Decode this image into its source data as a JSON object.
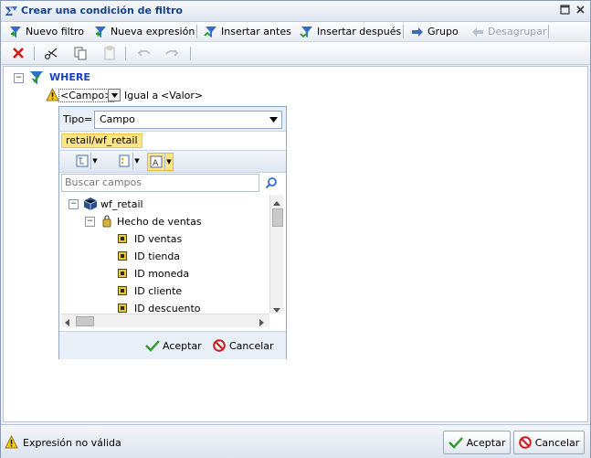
{
  "window": {
    "title": "Crear una condición de filtro"
  },
  "toolbar": {
    "nuevo_filtro": "Nuevo filtro",
    "nueva_expresion": "Nueva expresión",
    "insertar_antes": "Insertar antes",
    "insertar_despues": "Insertar después",
    "grupo": "Grupo",
    "desagrupar": "Desagrupar"
  },
  "filter": {
    "root": "WHERE",
    "field_placeholder": "<Campo>",
    "operator": "Igual a",
    "value_placeholder": "<Valor>"
  },
  "popup": {
    "tipo_label": "Tipo=",
    "tipo_value": "Campo",
    "breadcrumb": "retail/wf_retail",
    "search_placeholder": "Buscar campos",
    "tree": {
      "root": "wf_retail",
      "folder": "Hecho de ventas",
      "fields": [
        "ID ventas",
        "ID tienda",
        "ID moneda",
        "ID cliente",
        "ID descuento"
      ]
    },
    "accept": "Aceptar",
    "cancel": "Cancelar"
  },
  "status": {
    "message": "Expresión no válida",
    "accept": "Aceptar",
    "cancel": "Cancelar"
  },
  "colors": {
    "title_text": "#15428b",
    "where_text": "#1a3fc7",
    "breadcrumb_bg": "#fde489",
    "accent_blue": "#3d6bb3"
  }
}
